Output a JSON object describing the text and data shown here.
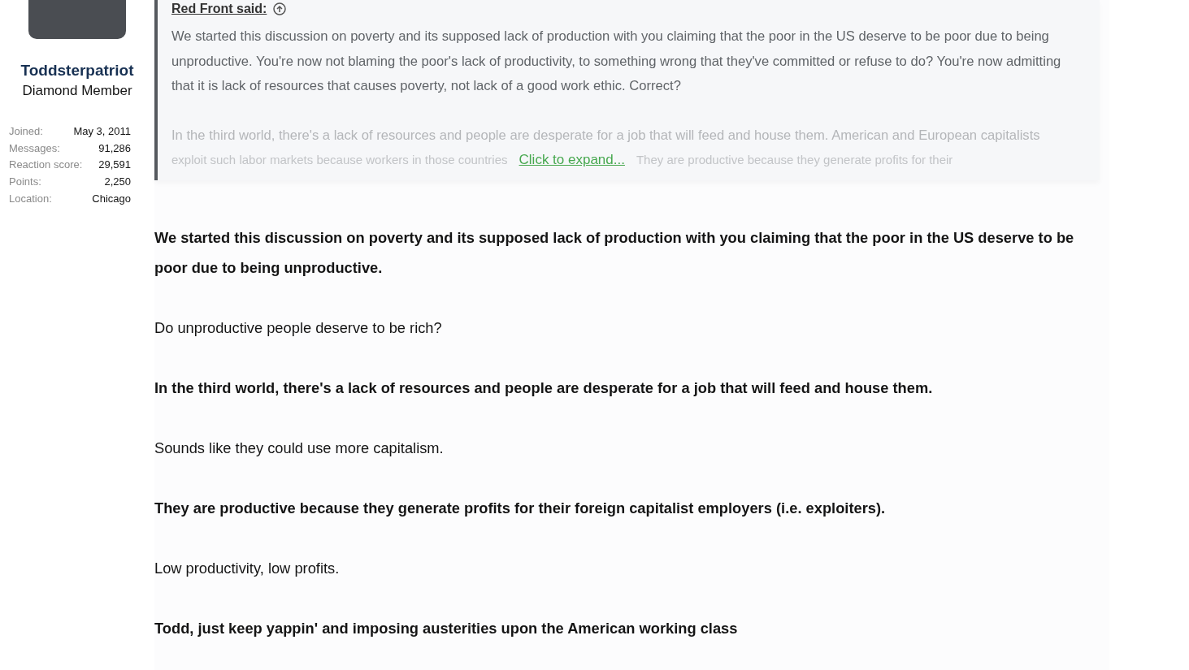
{
  "user": {
    "name": "Toddsterpatriot",
    "title": "Diamond Member",
    "stats": [
      {
        "label": "Joined:",
        "value": "May 3, 2011"
      },
      {
        "label": "Messages:",
        "value": "91,286"
      },
      {
        "label": "Reaction score:",
        "value": "29,591"
      },
      {
        "label": "Points:",
        "value": "2,250"
      },
      {
        "label": "Location:",
        "value": "Chicago"
      }
    ]
  },
  "quote": {
    "author": "Red Front said:",
    "paragraphs": [
      "We started this discussion on poverty and its supposed lack of production with you claiming that the poor in the US deserve to be poor due to being unproductive. You're now not blaming the poor's lack of productivity, to something wrong that they've committed or refuse to do? You're now admitting that it is lack of resources that causes poverty, not lack of a good work ethic. Correct?",
      "In the third world, there's a lack of resources and people are desperate for a job that will feed and house them. American and European capitalists"
    ],
    "cut_lines": [
      "exploit such labor markets because workers in those countries",
      "They are productive because they generate profits for their"
    ],
    "expand": "Click to expand..."
  },
  "body": [
    {
      "kind": "quoted",
      "text": "We started this discussion on poverty and its supposed lack of production with you claiming that the poor in the US deserve to be poor due to being unproductive."
    },
    {
      "kind": "reply",
      "text": "Do unproductive people deserve to be rich?"
    },
    {
      "kind": "quoted",
      "text": "In the third world, there's a lack of resources and people are desperate for a job that will feed and house them."
    },
    {
      "kind": "reply",
      "text": "Sounds like they could use more capitalism."
    },
    {
      "kind": "quoted",
      "text": "They are productive because they generate profits for their foreign capitalist employers (i.e. exploiters)."
    },
    {
      "kind": "reply",
      "text": "Low productivity, low profits."
    },
    {
      "kind": "quoted",
      "text": "Todd, just keep yappin' and imposing austerities upon the American working class"
    }
  ]
}
